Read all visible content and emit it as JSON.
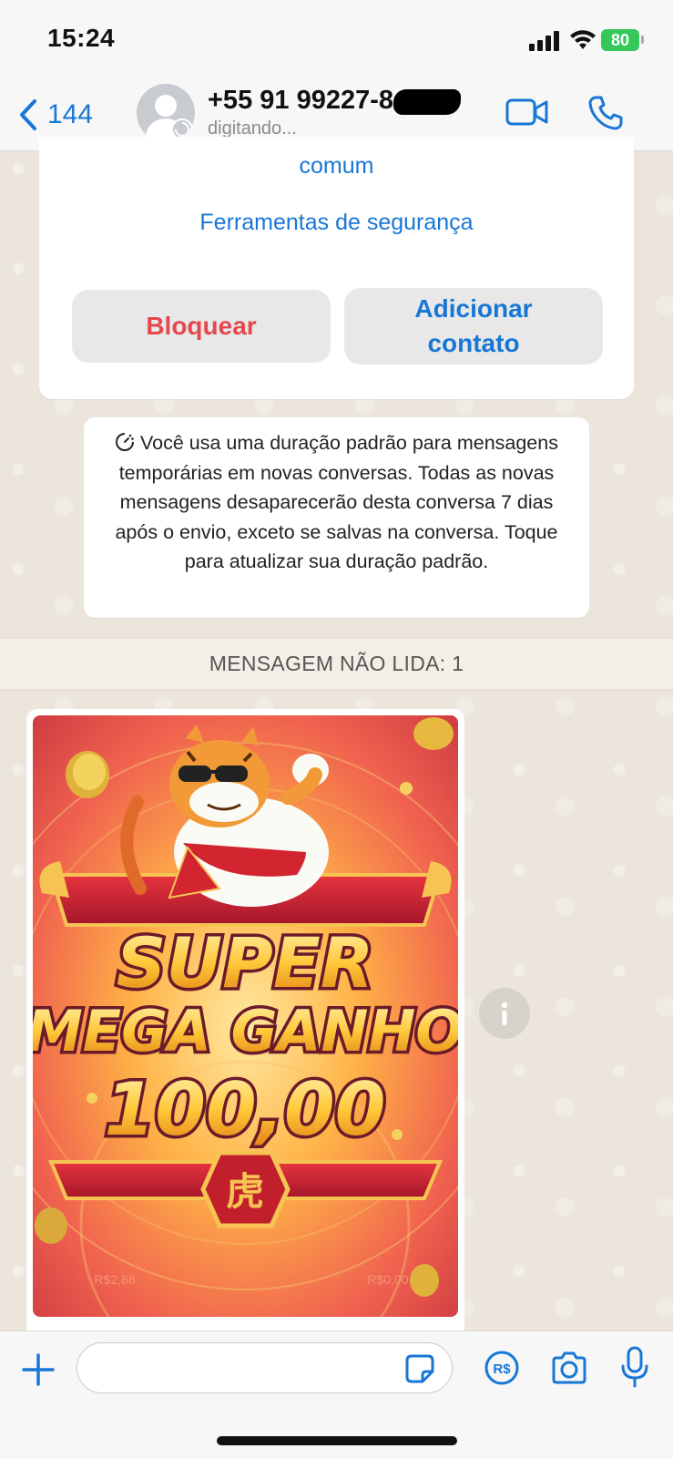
{
  "status_bar": {
    "time": "15:24",
    "battery_level": "80",
    "icons": [
      "cellular-signal-icon",
      "wifi-icon",
      "battery-charging-icon"
    ]
  },
  "header": {
    "back_count": "144",
    "contact_name": "+55 91 99227-8",
    "status": "digitando...",
    "icons": [
      "chevron-left-icon",
      "avatar-icon",
      "video-call-icon",
      "phone-icon"
    ],
    "accent_color": "#1877d6"
  },
  "card": {
    "line_fragment": "comum",
    "security_tools": "Ferramentas de segurança",
    "block_label": "Bloquear",
    "add_contact_label": "Adicionar contato",
    "block_color": "#e5484d"
  },
  "notice": {
    "text": "Você usa uma duração padrão para mensagens temporárias em novas conversas. Todas as novas mensagens desaparecerão desta conversa 7 dias após o envio, exceto se salvas na conversa. Toque para atualizar sua duração padrão."
  },
  "unread_banner": "MENSAGEM NÃO LIDA: 1",
  "message": {
    "promo_line1": "SUPER",
    "promo_line2": "MEGA GANHO",
    "amount": "100,00",
    "emblem": "虎",
    "left_small": "R$2,88",
    "right_small": "R$0,00"
  },
  "input_bar": {
    "placeholder": "",
    "icons": [
      "plus-icon",
      "sticker-icon",
      "pix-payment-icon",
      "camera-icon",
      "microphone-icon"
    ]
  }
}
